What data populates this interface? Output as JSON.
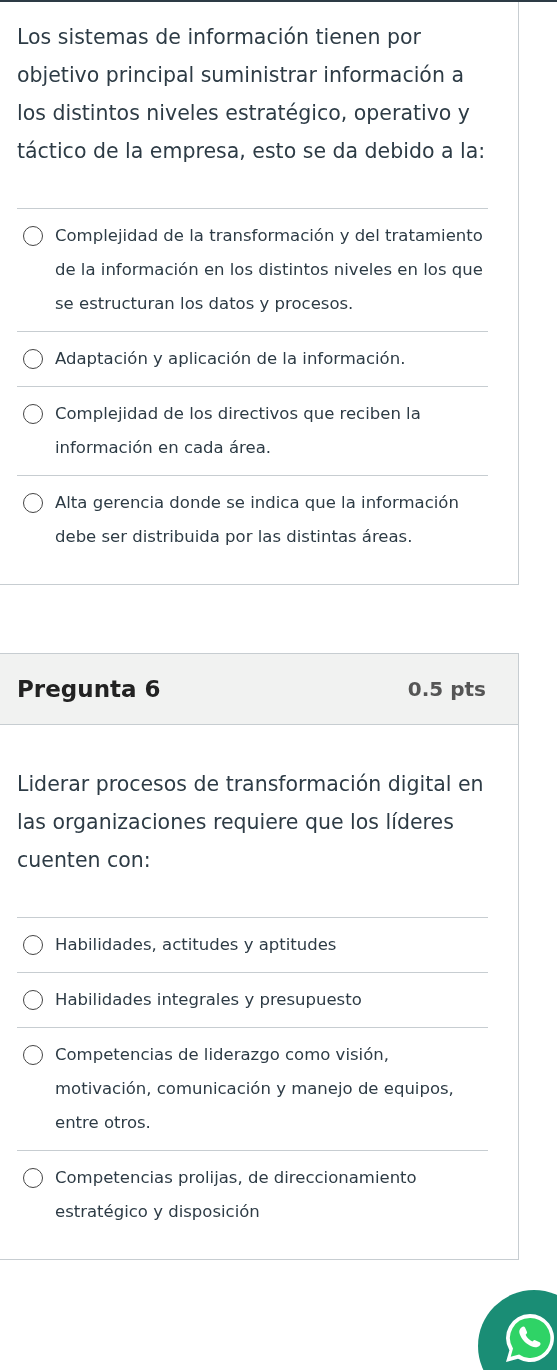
{
  "questions": [
    {
      "text": "Los sistemas de información tienen por objetivo principal suministrar información a los distintos niveles estratégico, operativo y táctico de la empresa, esto se da debido a la:",
      "answers": [
        {
          "text": "Complejidad de la transformación y del tratamiento de la información en los distintos niveles en los que se estructuran los datos y procesos.",
          "selected": false
        },
        {
          "text": "Adaptación y aplicación de la información.",
          "selected": false
        },
        {
          "text": "Complejidad de los directivos que reciben la información en cada área.",
          "selected": false
        },
        {
          "text": "Alta gerencia donde se indica que la información debe ser distribuida por las distintas áreas.",
          "selected": false
        }
      ]
    },
    {
      "title": "Pregunta 6",
      "points": "0.5 pts",
      "text": "Liderar procesos de transformación digital en las organizaciones requiere que los líderes cuenten con:",
      "answers": [
        {
          "text": "Habilidades, actitudes y aptitudes",
          "selected": false
        },
        {
          "text": "Habilidades integrales y presupuesto",
          "selected": false
        },
        {
          "text": "Competencias de liderazgo como visión, motivación, comunicación y manejo de equipos, entre otros.",
          "selected": false
        },
        {
          "text": "Competencias prolijas, de direccionamiento estratégico y disposición",
          "selected": false
        }
      ]
    }
  ]
}
